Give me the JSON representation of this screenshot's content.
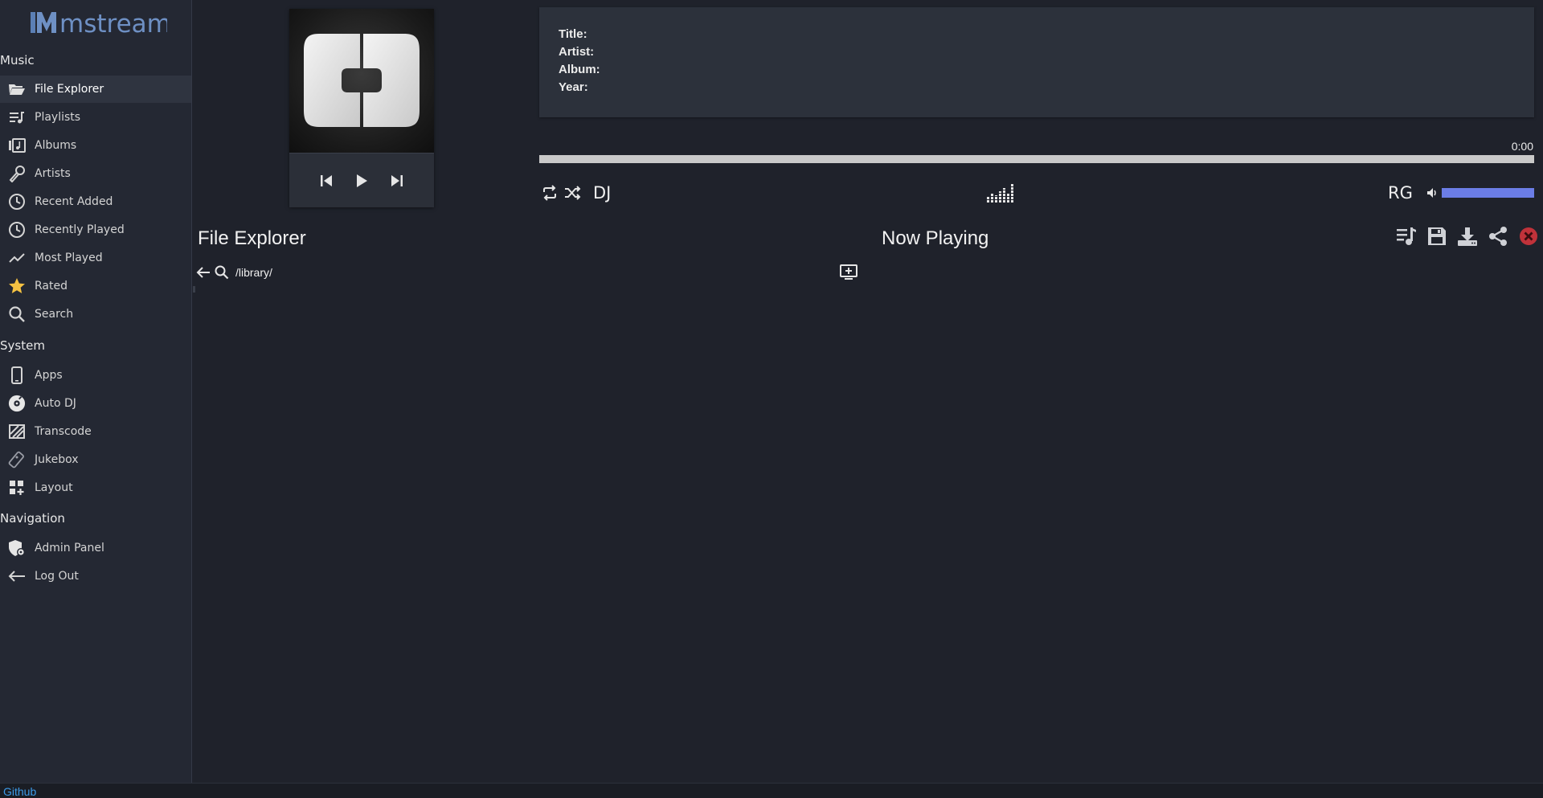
{
  "app": {
    "logo_text": "mstream"
  },
  "sidebar": {
    "sections": {
      "music": "Music",
      "system": "System",
      "navigation": "Navigation"
    },
    "music_items": [
      {
        "label": "File Explorer",
        "icon": "folder-open-icon",
        "active": true
      },
      {
        "label": "Playlists",
        "icon": "playlist-icon"
      },
      {
        "label": "Albums",
        "icon": "album-icon"
      },
      {
        "label": "Artists",
        "icon": "microphone-icon"
      },
      {
        "label": "Recent Added",
        "icon": "clock-icon"
      },
      {
        "label": "Recently Played",
        "icon": "clock-icon"
      },
      {
        "label": "Most Played",
        "icon": "trending-icon"
      },
      {
        "label": "Rated",
        "icon": "star-icon"
      },
      {
        "label": "Search",
        "icon": "search-icon"
      }
    ],
    "system_items": [
      {
        "label": "Apps",
        "icon": "phone-icon"
      },
      {
        "label": "Auto DJ",
        "icon": "disc-icon"
      },
      {
        "label": "Transcode",
        "icon": "transcode-icon"
      },
      {
        "label": "Jukebox",
        "icon": "remote-icon"
      },
      {
        "label": "Layout",
        "icon": "layout-icon"
      }
    ],
    "navigation_items": [
      {
        "label": "Admin Panel",
        "icon": "shield-icon"
      },
      {
        "label": "Log Out",
        "icon": "arrow-left-icon"
      }
    ]
  },
  "player": {
    "meta": {
      "title_label": "Title:",
      "artist_label": "Artist:",
      "album_label": "Album:",
      "year_label": "Year:"
    },
    "time": "0:00",
    "progress": 0,
    "dj_label": "DJ",
    "rg_label": "RG",
    "volume": 1.0
  },
  "file_explorer": {
    "title": "File Explorer",
    "path": "/library/"
  },
  "now_playing": {
    "title": "Now Playing"
  },
  "footer": {
    "github_label": "Github"
  },
  "colors": {
    "background": "#1f222b",
    "sidebar": "#242833",
    "accent": "#6b7de6",
    "link": "#3d9be9",
    "danger": "#c0323a"
  }
}
